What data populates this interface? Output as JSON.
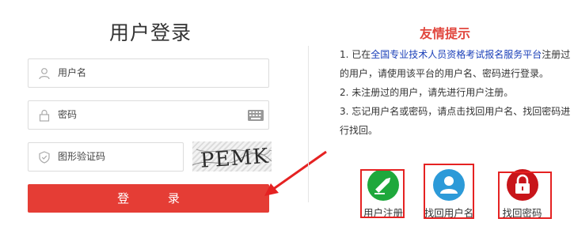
{
  "login": {
    "title": "用户登录",
    "username_placeholder": "用户名",
    "password_placeholder": "密码",
    "captcha_placeholder": "图形验证码",
    "captcha_text": "PEMK",
    "submit_label": "登 录"
  },
  "tips": {
    "title": "友情提示",
    "line1_prefix": "1. 已在",
    "line1_link": "全国专业技术人员资格考试报名服务平台",
    "line1_suffix": "注册过的用户，请使用该平台的用户名、密码进行登录。",
    "line2": "2. 未注册过的用户，请先进行用户注册。",
    "line3": "3. 忘记用户名或密码，请点击找回用户名、找回密码进行找回。"
  },
  "actions": {
    "register": "用户注册",
    "find_username": "找回用户名",
    "find_password": "找回密码"
  },
  "colors": {
    "accent_red": "#e53d35",
    "link_blue": "#1a3fb8",
    "register_green": "#1ea83c",
    "username_blue": "#2c9ad8",
    "password_red": "#c8151a"
  }
}
